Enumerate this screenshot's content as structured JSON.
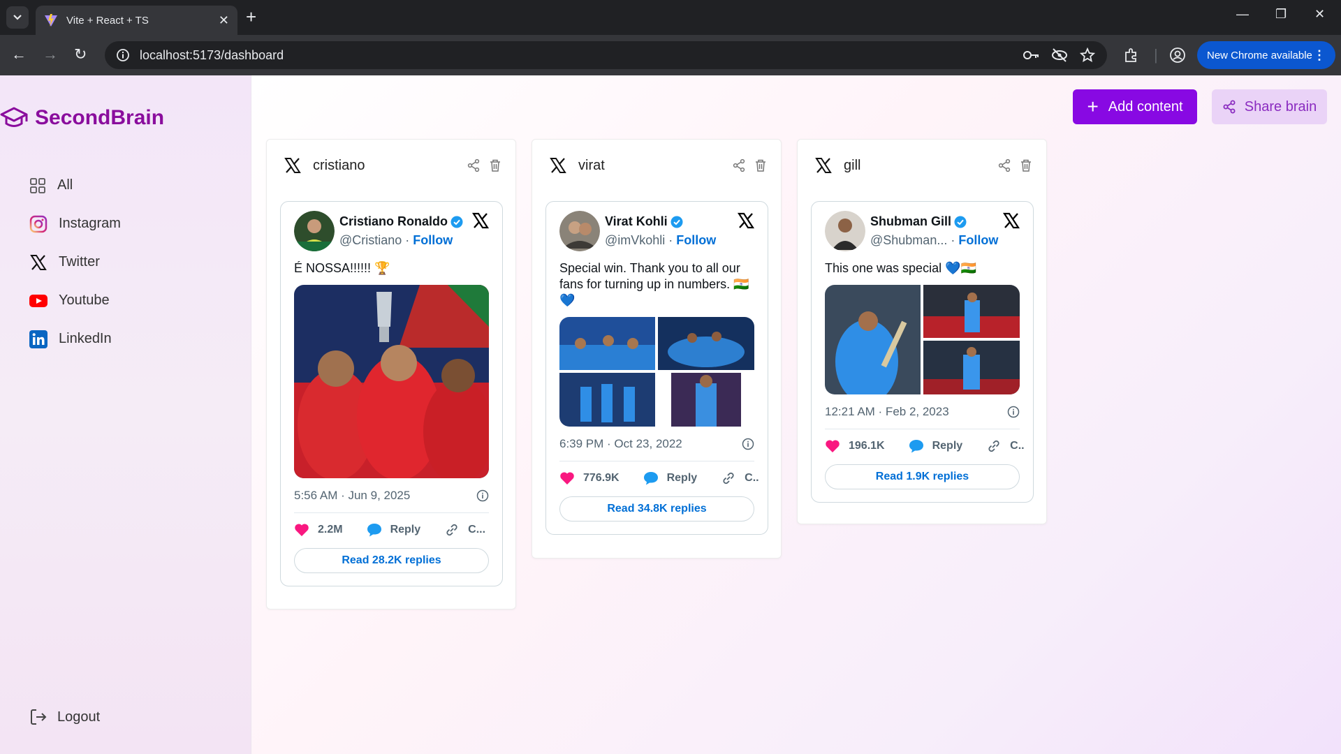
{
  "browser": {
    "tab_title": "Vite + React + TS",
    "url": "localhost:5173/dashboard",
    "update_label": "New Chrome available"
  },
  "sidebar": {
    "brand": "SecondBrain",
    "items": [
      {
        "label": "All",
        "icon": "grid-icon"
      },
      {
        "label": "Instagram",
        "icon": "instagram-icon"
      },
      {
        "label": "Twitter",
        "icon": "x-icon"
      },
      {
        "label": "Youtube",
        "icon": "youtube-icon"
      },
      {
        "label": "LinkedIn",
        "icon": "linkedin-icon"
      }
    ],
    "logout": "Logout"
  },
  "toolbar": {
    "add_label": "Add content",
    "share_label": "Share brain"
  },
  "colors": {
    "brand": "#8a0d9d",
    "primary": "#8809e3",
    "secondary": "#ead3f7",
    "like": "#f91880",
    "link": "#006fd6"
  },
  "cards": [
    {
      "title": "cristiano",
      "tweet": {
        "name": "Cristiano Ronaldo",
        "handle": "@Cristiano",
        "sep": " · ",
        "follow": "Follow",
        "text": "É NOSSA!!!!!! 🏆",
        "time": "5:56 AM · Jun 9, 2025",
        "likes": "2.2M",
        "reply": "Reply",
        "copy": "C...",
        "replies": "Read 28.2K replies"
      }
    },
    {
      "title": "virat",
      "tweet": {
        "name": "Virat Kohli",
        "handle": "@imVkohli",
        "sep": " · ",
        "follow": "Follow",
        "text": "Special win. Thank you to all our fans for turning up in numbers. 🇮🇳 💙",
        "time": "6:39 PM · Oct 23, 2022",
        "likes": "776.9K",
        "reply": "Reply",
        "copy": "C..",
        "replies": "Read 34.8K replies"
      }
    },
    {
      "title": "gill",
      "tweet": {
        "name": "Shubman Gill",
        "handle": "@Shubman...",
        "sep": " · ",
        "follow": "Follow",
        "text": "This one was special 💙🇮🇳",
        "time": "12:21 AM · Feb 2, 2023",
        "likes": "196.1K",
        "reply": "Reply",
        "copy": "C..",
        "replies": "Read 1.9K replies"
      }
    }
  ]
}
